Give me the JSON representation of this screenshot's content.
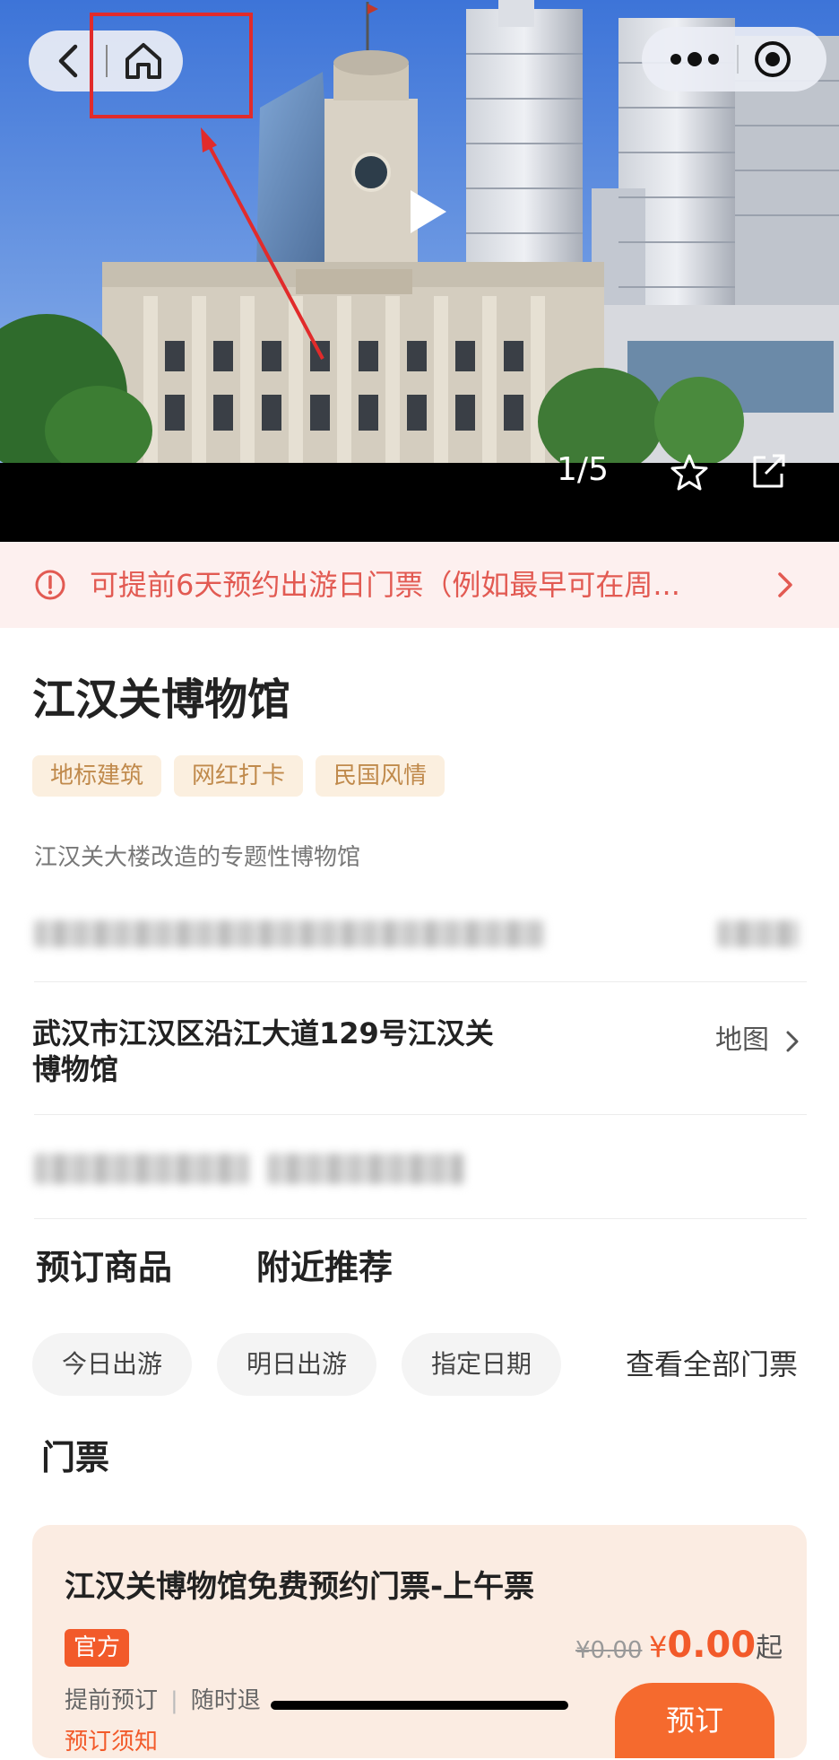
{
  "gallery": {
    "counter": "1/5",
    "accent_highlight": "#e12b2b",
    "icons": [
      "back-icon",
      "home-icon",
      "more-icon",
      "target-icon",
      "play-icon",
      "star-icon",
      "share-icon"
    ]
  },
  "notice": {
    "text": "可提前6天预约出游日门票（例如最早可在周...",
    "color": "#e25a52"
  },
  "poi": {
    "title": "江汉关博物馆",
    "tags": [
      "地标建筑",
      "网红打卡",
      "民国风情"
    ],
    "description": "江汉关大楼改造的专题性博物馆",
    "address": "武汉市江汉区沿江大道129号江汉关博物馆",
    "map_label": "地图"
  },
  "tabs": {
    "booking": "预订商品",
    "nearby": "附近推荐"
  },
  "date_filters": [
    "今日出游",
    "明日出游",
    "指定日期"
  ],
  "view_all": "查看全部门票",
  "ticket_section": "门票",
  "ticket": {
    "name": "江汉关博物馆免费预约门票-上午票",
    "badge": "官方",
    "original_price": "¥0.00",
    "price_symbol": "¥",
    "price": "0.00",
    "price_suffix": "起",
    "feature_1": "提前预订",
    "separator": "|",
    "feature_2": "随时退",
    "notes": "预订须知",
    "book_label": "预订",
    "accent": "#f25a2a"
  }
}
